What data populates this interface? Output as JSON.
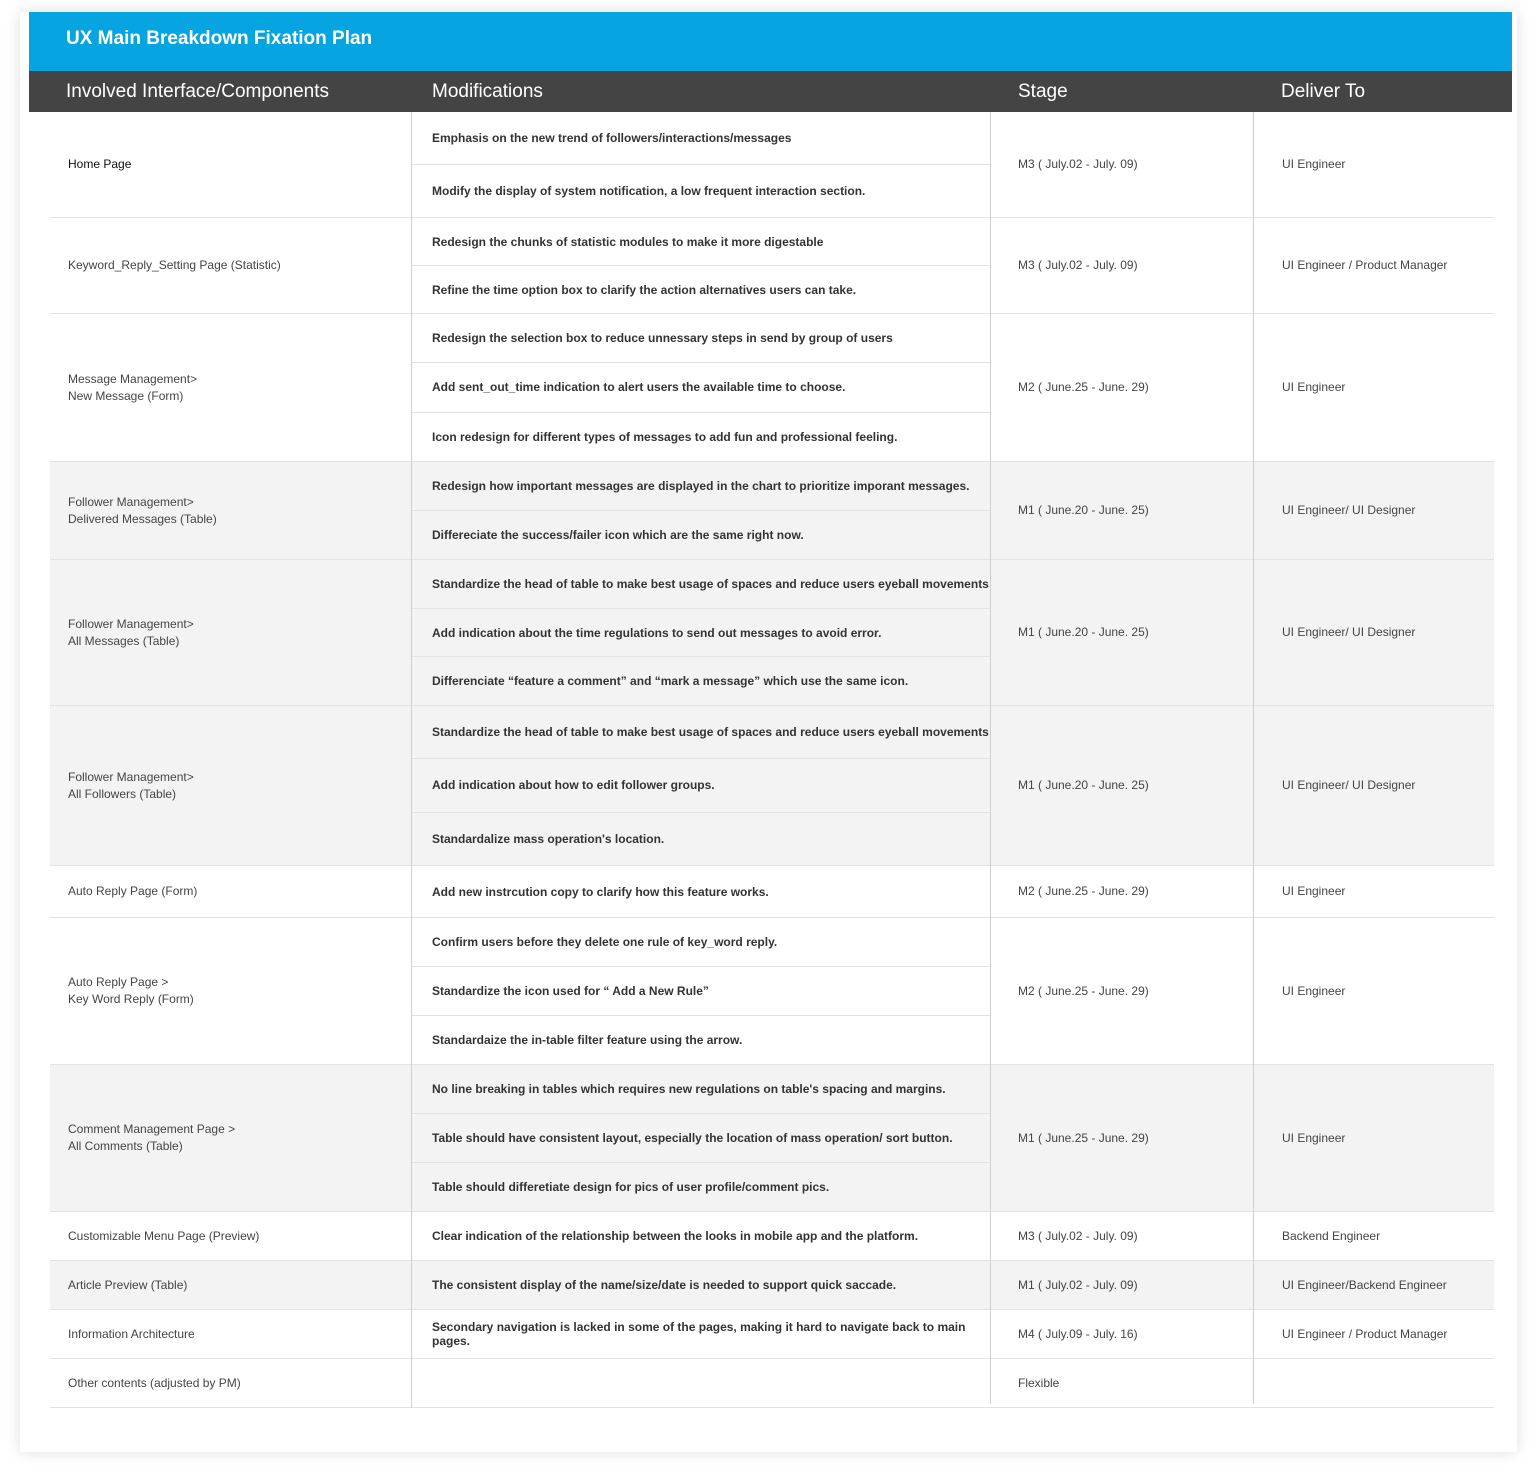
{
  "title": "UX Main Breakdown Fixation Plan",
  "headers": {
    "interface": "Involved Interface/Components",
    "modifications": "Modifications",
    "stage": "Stage",
    "deliver": "Deliver To"
  },
  "rows": [
    {
      "interface": [
        "Home Page"
      ],
      "modifications": [
        "Emphasis on the new trend of followers/interactions/messages",
        "Modify the display of system notification, a low frequent interaction section."
      ],
      "stage": "M3 ( July.02 - July. 09)",
      "deliver": "UI Engineer"
    },
    {
      "interface": [
        "Keyword_Reply_Setting Page (Statistic)"
      ],
      "modifications": [
        "Redesign the chunks of statistic modules to make it more digestable",
        "Refine the time option box to clarify the action alternatives users can take."
      ],
      "stage": "M3 ( July.02 - July. 09)",
      "deliver": "UI Engineer / Product Manager"
    },
    {
      "interface": [
        "Message Management>",
        "New Message (Form)"
      ],
      "modifications": [
        "Redesign the selection box to reduce unnessary steps in send by group of users",
        "Add sent_out_time indication to alert users the available time to choose.",
        "Icon redesign for different types of messages to add fun and professional feeling."
      ],
      "stage": "M2 ( June.25 - June. 29)",
      "deliver": "UI Engineer"
    },
    {
      "interface": [
        "Follower Management>",
        "Delivered Messages (Table)"
      ],
      "modifications": [
        "Redesign how important messages are displayed in the chart to prioritize imporant messages.",
        "Differeciate the success/failer icon which are the same right now."
      ],
      "stage": "M1 ( June.20 - June. 25)",
      "deliver": "UI Engineer/ UI Designer"
    },
    {
      "interface": [
        "Follower Management>",
        "All Messages (Table)"
      ],
      "modifications": [
        "Standardize the head of table to make best usage of spaces and reduce users eyeball movements",
        "Add indication about the time regulations to send out messages to avoid error.",
        "Differenciate “feature a comment” and “mark a message” which use the same icon."
      ],
      "stage": "M1 ( June.20 - June. 25)",
      "deliver": "UI Engineer/ UI Designer"
    },
    {
      "interface": [
        "Follower Management>",
        "All Followers (Table)"
      ],
      "modifications": [
        "Standardize the head of table to make best usage of spaces and reduce users eyeball movements",
        "Add indication about how to edit follower groups.",
        "Standardalize mass operation's location."
      ],
      "stage": "M1 ( June.20 - June. 25)",
      "deliver": "UI Engineer/ UI Designer"
    },
    {
      "interface": [
        "Auto Reply Page (Form)"
      ],
      "modifications": [
        "Add new instrcution copy to clarify how this feature works."
      ],
      "stage": "M2 ( June.25 - June. 29)",
      "deliver": "UI Engineer"
    },
    {
      "interface": [
        "Auto Reply Page >",
        "Key Word Reply (Form)"
      ],
      "modifications": [
        "Confirm users before they delete one rule of key_word reply.",
        "Standardize the icon used for “ Add a New Rule”",
        "Standardaize the in-table filter feature using the arrow."
      ],
      "stage": "M2 ( June.25 - June. 29)",
      "deliver": "UI Engineer"
    },
    {
      "interface": [
        "Comment Management Page >",
        "All Comments (Table)"
      ],
      "modifications": [
        "No line breaking in tables which requires new regulations on table's spacing and margins.",
        "Table should have consistent layout, especially the location of mass operation/ sort button.",
        "Table should differetiate design for pics of user profile/comment pics."
      ],
      "stage": "M1 ( June.25 - June. 29)",
      "deliver": "UI Engineer"
    },
    {
      "interface": [
        "Customizable Menu Page (Preview)"
      ],
      "modifications": [
        "Clear indication of the relationship between the looks in mobile app and the platform."
      ],
      "stage": "M3 ( July.02 - July. 09)",
      "deliver": "Backend Engineer"
    },
    {
      "interface": [
        "Article Preview (Table)"
      ],
      "modifications": [
        "The consistent display of the name/size/date is needed to support quick saccade."
      ],
      "stage": "M1 ( July.02 - July. 09)",
      "deliver": "UI Engineer/Backend Engineer"
    },
    {
      "interface": [
        "Information Architecture"
      ],
      "modifications": [
        "Secondary navigation is lacked in some of the pages, making it hard to navigate back to main pages."
      ],
      "stage": "M4 ( July.09 - July. 16)",
      "deliver": "UI Engineer / Product Manager"
    },
    {
      "interface": [
        "Other contents (adjusted by PM)"
      ],
      "modifications": [],
      "stage": "Flexible",
      "deliver": ""
    }
  ]
}
